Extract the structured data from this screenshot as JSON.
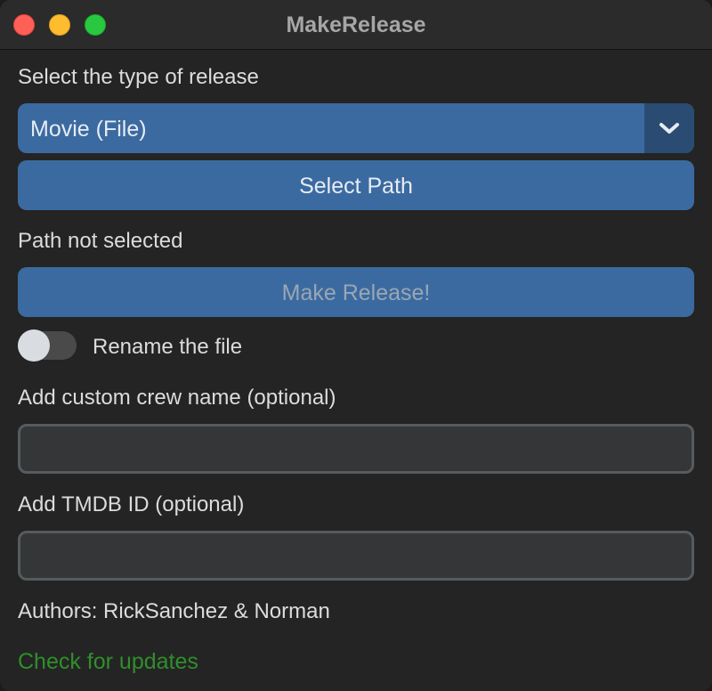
{
  "window": {
    "title": "MakeRelease"
  },
  "release_type": {
    "label": "Select the type of release",
    "selected": "Movie (File)"
  },
  "select_path_button": "Select Path",
  "path_status": "Path not selected",
  "make_release_button": "Make Release!",
  "rename_toggle": {
    "label": "Rename the file",
    "on": false
  },
  "crew_name": {
    "label": "Add custom crew name (optional)",
    "value": ""
  },
  "tmdb_id": {
    "label": "Add TMDB ID (optional)",
    "value": ""
  },
  "authors": "Authors: RickSanchez & Norman",
  "check_updates_link": "Check for updates",
  "colors": {
    "accent": "#3b6aa0",
    "accent_dark": "#2a4c73",
    "link": "#2f8f2a",
    "background": "#242424"
  },
  "icons": {
    "dropdown": "chevron-down-icon"
  }
}
